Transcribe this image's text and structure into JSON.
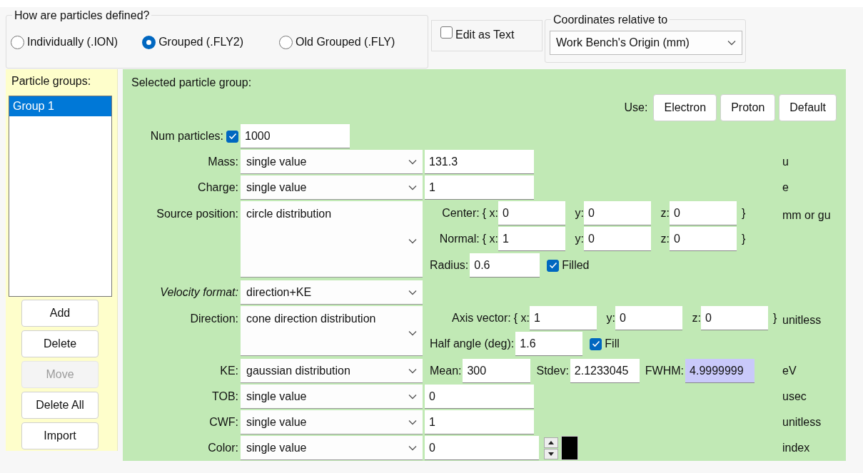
{
  "particle_definition": {
    "title": "How are particles defined?",
    "options": [
      {
        "label": "Individually (.ION)",
        "selected": false
      },
      {
        "label": "Grouped (.FLY2)",
        "selected": true
      },
      {
        "label": "Old Grouped (.FLY)",
        "selected": false
      }
    ]
  },
  "edit_as_text": {
    "label": "Edit as Text",
    "checked": false
  },
  "coordinates": {
    "title": "Coordinates relative to",
    "value": "Work Bench's Origin (mm)"
  },
  "particle_groups": {
    "title": "Particle groups:",
    "items": [
      {
        "label": "Group 1",
        "selected": true
      }
    ],
    "buttons": [
      {
        "label": "Add",
        "disabled": false
      },
      {
        "label": "Delete",
        "disabled": false
      },
      {
        "label": "Move",
        "disabled": true
      },
      {
        "label": "Delete All",
        "disabled": false
      },
      {
        "label": "Import",
        "disabled": false
      }
    ]
  },
  "selected_group": {
    "title": "Selected particle group:",
    "use_label": "Use:",
    "use_buttons": [
      "Electron",
      "Proton",
      "Default"
    ],
    "num_particles": {
      "label": "Num particles:",
      "checked": true,
      "value": "1000"
    },
    "rows": [
      {
        "kind": "simple",
        "label": "Mass:",
        "mode": "single value",
        "value": "131.3",
        "unit": "u"
      },
      {
        "kind": "simple",
        "label": "Charge:",
        "mode": "single value",
        "value": "1",
        "unit": "e"
      },
      {
        "kind": "circle",
        "label": "Source position:",
        "mode": "circle distribution",
        "vectors": [
          {
            "label": "Center:",
            "fields": [
              {
                "prefix": "{ x:",
                "value": "0"
              },
              {
                "prefix": "y:",
                "value": "0"
              },
              {
                "prefix": "z:",
                "value": "0"
              }
            ],
            "close": "}"
          },
          {
            "label": "Normal:",
            "fields": [
              {
                "prefix": "{ x:",
                "value": "1"
              },
              {
                "prefix": "y:",
                "value": "0"
              },
              {
                "prefix": "z:",
                "value": "0"
              }
            ],
            "close": "}"
          }
        ],
        "extra": {
          "label": "Radius:",
          "value": "0.6"
        },
        "check": {
          "label": "Filled",
          "checked": true
        },
        "unit": "mm or gu"
      },
      {
        "kind": "format",
        "label": "Velocity format:",
        "mode": "direction+KE"
      },
      {
        "kind": "cone",
        "label": "Direction:",
        "mode": "cone direction distribution",
        "vectors": [
          {
            "label": "Axis vector:",
            "fields": [
              {
                "prefix": "{ x:",
                "value": "1"
              },
              {
                "prefix": "y:",
                "value": "0"
              },
              {
                "prefix": "z:",
                "value": "0"
              }
            ],
            "close": "}"
          }
        ],
        "extra": {
          "label": "Half angle (deg):",
          "value": "1.6"
        },
        "check": {
          "label": "Fill",
          "checked": true
        },
        "unit": "unitless"
      },
      {
        "kind": "gaussian",
        "label": "KE:",
        "mode": "gaussian distribution",
        "params": [
          {
            "label": "Mean:",
            "value": "300",
            "highlighted": false
          },
          {
            "label": "Stdev:",
            "value": "2.1233045",
            "highlighted": false
          },
          {
            "label": "FWHM:",
            "value": "4.9999999",
            "highlighted": true
          }
        ],
        "unit": "eV"
      },
      {
        "kind": "simple",
        "label": "TOB:",
        "mode": "single value",
        "value": "0",
        "unit": "usec"
      },
      {
        "kind": "simple",
        "label": "CWF:",
        "mode": "single value",
        "value": "1",
        "unit": "unitless"
      },
      {
        "kind": "color",
        "label": "Color:",
        "mode": "single value",
        "value": "0",
        "color": "#000000",
        "unit": "index"
      }
    ]
  }
}
